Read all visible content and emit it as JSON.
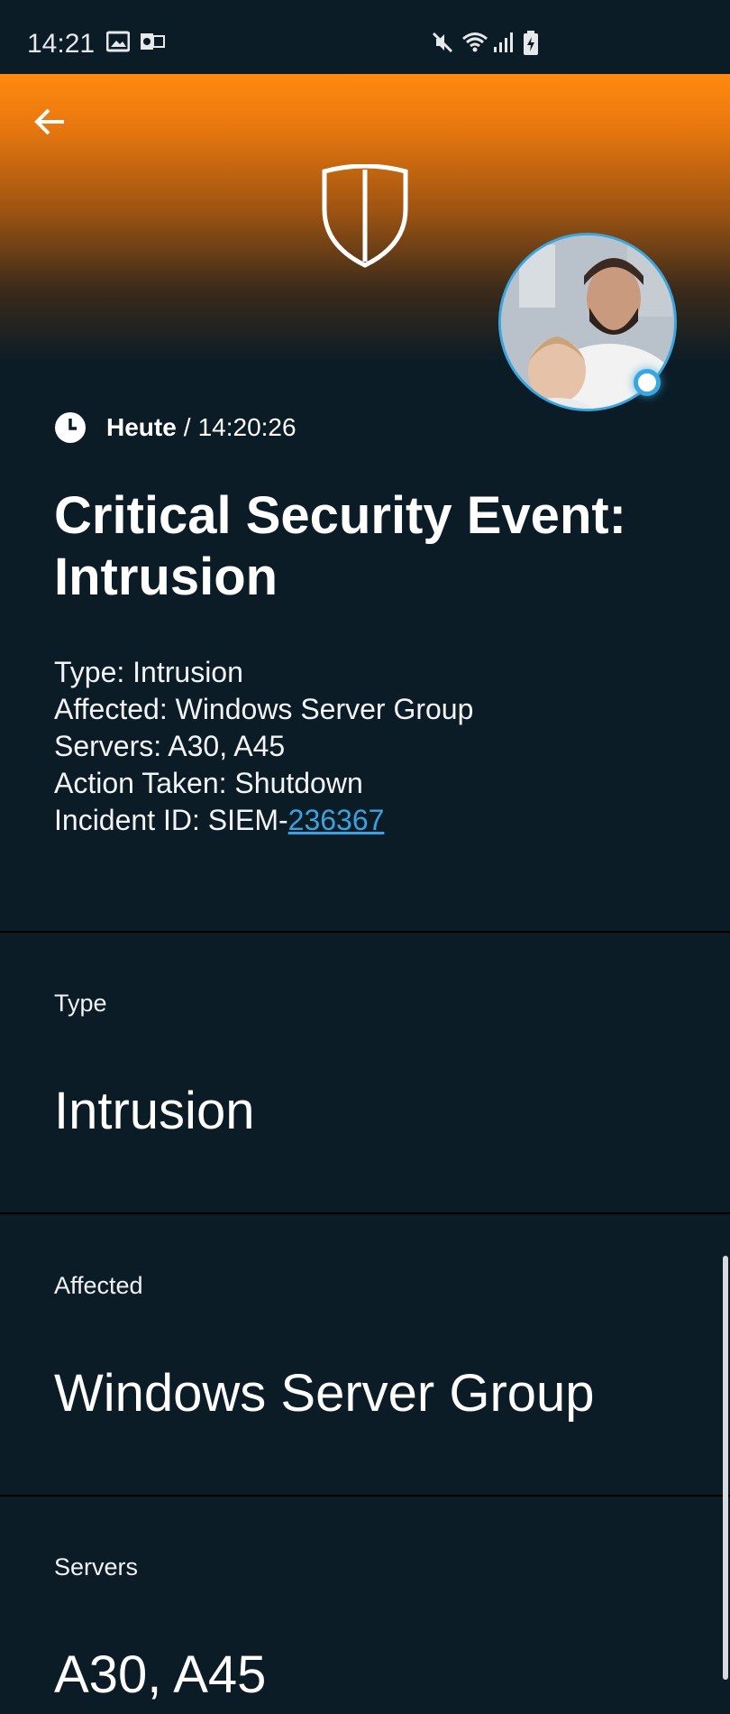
{
  "status_bar": {
    "time": "14:21",
    "left_icons": [
      "image-icon",
      "outlook-icon"
    ],
    "right_icons": [
      "mute-icon",
      "wifi-icon",
      "signal-icon",
      "battery-charging-icon"
    ]
  },
  "header": {
    "gradient_colors": [
      "#ff8a0e",
      "#0b1c27"
    ],
    "back_icon": "arrow-left-icon",
    "logo_icon": "shield-icon",
    "avatar": "user-avatar-photo",
    "presence_color": "#3aa6df"
  },
  "event": {
    "day": "Heute",
    "separator": "/",
    "time": "14:20:26",
    "title": "Critical Security Event: Intrusion",
    "summary": {
      "type_line": "Type: Intrusion",
      "affected_line": "Affected: Windows Server Group",
      "servers_line": "Servers: A30, A45",
      "action_line": "Action Taken: Shutdown",
      "incident_prefix": "Incident ID: SIEM-",
      "incident_number": "236367"
    }
  },
  "fields": [
    {
      "label": "Type",
      "value": "Intrusion"
    },
    {
      "label": "Affected",
      "value": "Windows Server Group"
    },
    {
      "label": "Servers",
      "value": "A30, A45"
    }
  ],
  "colors": {
    "background": "#0b1c27",
    "link": "#39a2df",
    "accent_orange": "#ff8a0e"
  }
}
